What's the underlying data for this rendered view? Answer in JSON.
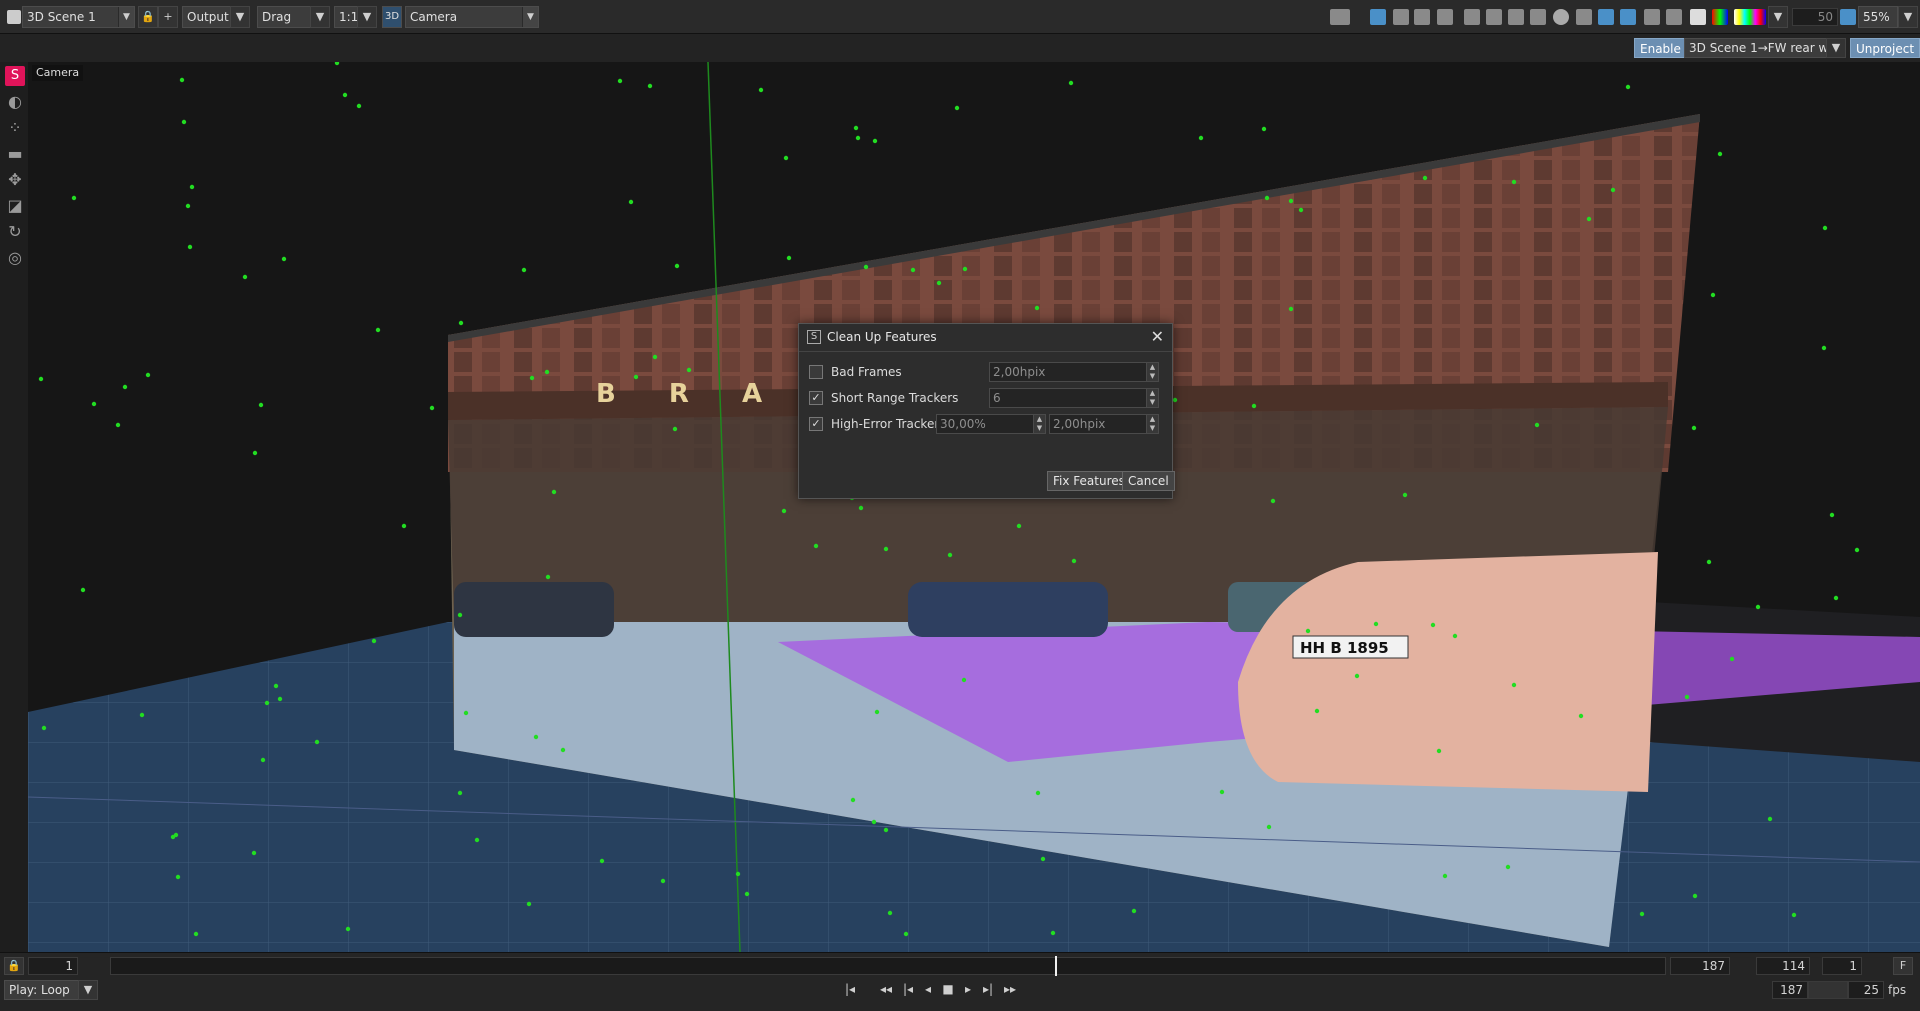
{
  "toolbar": {
    "scene": "3D Scene 1",
    "output": "Output",
    "drag": "Drag",
    "ratio": "1:1",
    "view_badge": "3D",
    "camera": "Camera",
    "frame_field": "50",
    "zoom": "55%"
  },
  "subbar": {
    "enable": "Enable",
    "layer": "3D Scene 1→FW rear wall",
    "unproject": "Unproject"
  },
  "viewport": {
    "label": "Camera",
    "sign_text": "B R A H         N T O R",
    "plate_text": "HH B 1895"
  },
  "dialog": {
    "title": "Clean Up Features",
    "rows": [
      {
        "label": "Bad Frames",
        "checked": false,
        "values": [
          "2,00hpix"
        ]
      },
      {
        "label": "Short Range Trackers",
        "checked": true,
        "values": [
          "6"
        ]
      },
      {
        "label": "High-Error Trackers",
        "checked": true,
        "values": [
          "30,00%",
          "2,00hpix"
        ]
      }
    ],
    "fix_button": "Fix Features",
    "cancel_button": "Cancel",
    "check_mark": "✓"
  },
  "bottom": {
    "start_frame": "1",
    "end_frame": "187",
    "current_frame": "114",
    "step": "1",
    "f_button": "F",
    "play_mode": "Play: Loop",
    "total_frames": "187",
    "fps_value": "25",
    "fps_label": "fps"
  },
  "colors": {
    "accent_pink": "#e0145a",
    "track_point": "#22dd22",
    "ground_blue": "#27415f",
    "planar_purple": "#a855e6"
  }
}
